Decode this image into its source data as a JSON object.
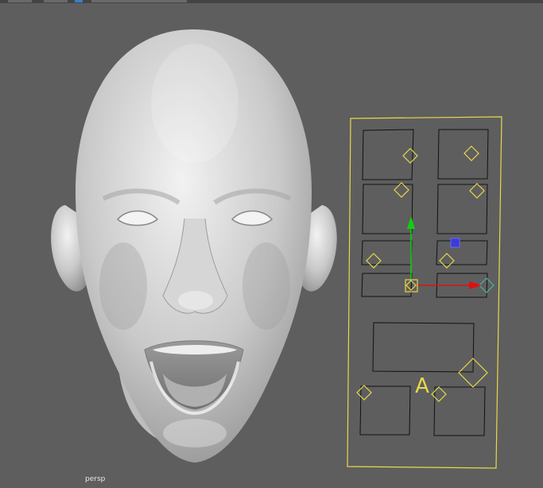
{
  "viewport": {
    "camera_label": "persp",
    "background_color": "#5e5e5e"
  },
  "face_model": {
    "icon": "head-mesh",
    "color": "#d4d4d4"
  },
  "rig_panel": {
    "frame_color": "#e8d84a",
    "controls": [
      {
        "name": "brow-left-control"
      },
      {
        "name": "brow-right-control"
      },
      {
        "name": "eye-left-control"
      },
      {
        "name": "eye-right-control"
      },
      {
        "name": "cheek-left-control"
      },
      {
        "name": "cheek-right-control"
      },
      {
        "name": "mouth-corner-left-control"
      },
      {
        "name": "mouth-corner-right-control"
      },
      {
        "name": "jaw-control"
      },
      {
        "name": "lip-left-control"
      },
      {
        "name": "lip-right-control"
      }
    ],
    "jaw_letter": "A"
  },
  "manipulator": {
    "x_axis_color": "#e01010",
    "y_axis_color": "#10d010",
    "center_color": "#e8d84a"
  }
}
